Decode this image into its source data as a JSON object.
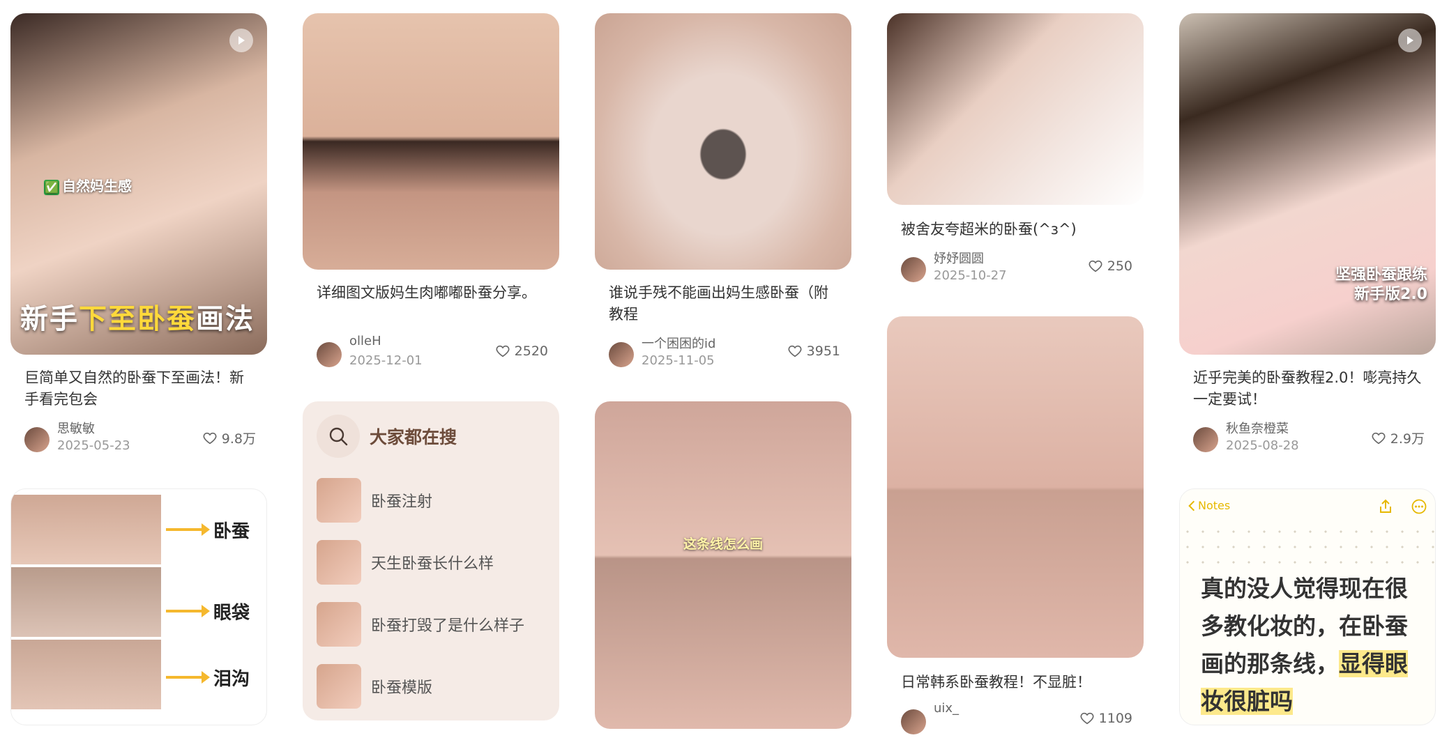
{
  "cards": {
    "c1": {
      "overlay_check": "✅",
      "overlay_small": "自然妈生感",
      "overlay_big_a": "新手",
      "overlay_big_b": "下至卧蚕",
      "overlay_big_c": "画法",
      "title": "巨简单又自然的卧蚕下至画法！新手看完包会",
      "author": "思敏敏",
      "date": "2025-05-23",
      "likes": "9.8万"
    },
    "c2": {
      "title": "详细图文版妈生肉嘟嘟卧蚕分享。",
      "author": "olleH",
      "date": "2025-12-01",
      "likes": "2520"
    },
    "c3": {
      "title": "谁说手残不能画出妈生感卧蚕（附教程",
      "author": "一个困困的id",
      "date": "2025-11-05",
      "likes": "3951"
    },
    "c4": {
      "title": "被舍友夸超米的卧蚕(^ɜ^)",
      "author": "妤妤圆圆",
      "date": "2025-10-27",
      "likes": "250"
    },
    "c5": {
      "overlay_line1": "坚强卧蚕跟练",
      "overlay_line2": "新手版2.0",
      "title": "近乎完美的卧蚕教程2.0！嘭亮持久一定要试！",
      "author": "秋鱼奈橙菜",
      "date": "2025-08-28",
      "likes": "2.9万"
    },
    "c6": {
      "labels": [
        "卧蚕",
        "眼袋",
        "泪沟"
      ]
    },
    "c7": {
      "overlay": "这条线怎么画"
    },
    "c8": {
      "title": "日常韩系卧蚕教程！不显脏！",
      "author": "uix_",
      "likes": "1109"
    },
    "c9": {
      "back_label": "Notes",
      "body_a": "真的没人觉得现在很多教化妆的，在卧蚕画的那条线，",
      "body_b": "显得眼妆很脏吗"
    }
  },
  "search": {
    "title": "大家都在搜",
    "items": [
      {
        "label": "卧蚕注射"
      },
      {
        "label": "天生卧蚕长什么样"
      },
      {
        "label": "卧蚕打毁了是什么样子"
      },
      {
        "label": "卧蚕模版"
      }
    ]
  },
  "icons": {
    "play": "play-icon",
    "heart": "heart-icon",
    "search": "search-icon",
    "share": "share-icon",
    "more": "more-icon",
    "back": "chevron-left-icon"
  },
  "colors": {
    "accent_yellow": "#ffd93b",
    "search_bg": "#f5ebe6",
    "notes_yellow": "#e6b800"
  }
}
